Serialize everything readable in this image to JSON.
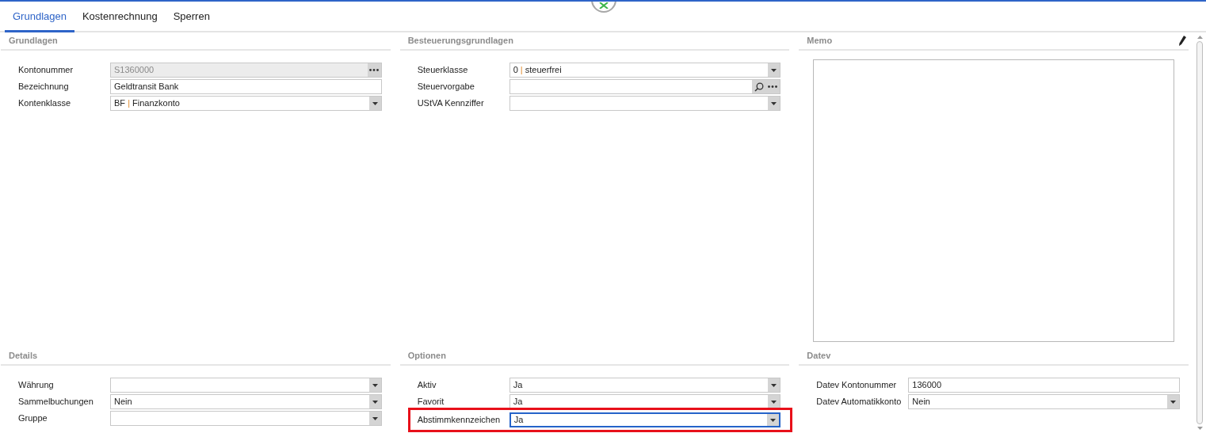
{
  "tabs": [
    {
      "label": "Grundlagen",
      "selected": true
    },
    {
      "label": "Kostenrechnung",
      "selected": false
    },
    {
      "label": "Sperren",
      "selected": false
    }
  ],
  "sections": [
    {
      "title": "Grundlagen",
      "fields": [
        {
          "label": "Kontonummer",
          "kind": "picker",
          "value": "S1360000",
          "disabled": true,
          "focused": false,
          "highlighted": false
        },
        {
          "label": "Bezeichnung",
          "kind": "text",
          "value": "Geldtransit Bank",
          "disabled": false,
          "focused": false,
          "highlighted": false
        },
        {
          "label": "Kontenklasse",
          "kind": "select",
          "code": "BF",
          "separator": "|",
          "value": "Finanzkonto",
          "disabled": false,
          "focused": false,
          "highlighted": false
        }
      ]
    },
    {
      "title": "Besteuerungsgrundlagen",
      "fields": [
        {
          "label": "Steuerklasse",
          "kind": "select",
          "code": "0",
          "separator": "|",
          "value": "steuerfrei",
          "disabled": false,
          "focused": false,
          "highlighted": false
        },
        {
          "label": "Steuervorgabe",
          "kind": "lookup",
          "disabled": false,
          "focused": false,
          "highlighted": false
        },
        {
          "label": "UStVA Kennziffer",
          "kind": "select",
          "disabled": false,
          "focused": false,
          "highlighted": false
        }
      ]
    },
    {
      "title": "Memo",
      "kind": "memo"
    },
    {
      "title": "Details",
      "fields": [
        {
          "label": "Währung",
          "kind": "select",
          "disabled": false,
          "focused": false,
          "highlighted": false
        },
        {
          "label": "Sammelbuchungen",
          "kind": "select",
          "value": "Nein",
          "disabled": false,
          "focused": false,
          "highlighted": false
        },
        {
          "label": "Gruppe",
          "kind": "select",
          "disabled": false,
          "focused": false,
          "highlighted": false
        }
      ]
    },
    {
      "title": "Optionen",
      "fields": [
        {
          "label": "Aktiv",
          "kind": "select",
          "value": "Ja",
          "disabled": false,
          "focused": false,
          "highlighted": false
        },
        {
          "label": "Favorit",
          "kind": "select",
          "value": "Ja",
          "disabled": false,
          "focused": false,
          "highlighted": false
        },
        {
          "label": "Abstimmkennzeichen",
          "kind": "select",
          "value": "Ja",
          "disabled": false,
          "focused": true,
          "highlighted": true
        }
      ]
    },
    {
      "title": "Datev",
      "fields": [
        {
          "label": "Datev Kontonummer",
          "kind": "text",
          "value": "136000",
          "disabled": false,
          "focused": false,
          "highlighted": false
        },
        {
          "label": "Datev Automatikkonto",
          "kind": "select",
          "value": "Nein",
          "disabled": false,
          "focused": false,
          "highlighted": false
        }
      ]
    }
  ]
}
